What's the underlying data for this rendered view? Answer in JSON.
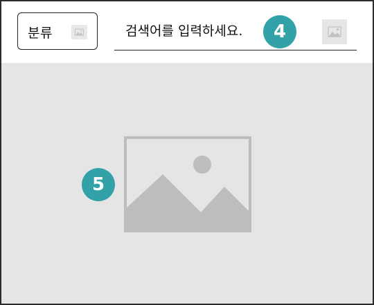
{
  "category": {
    "label": "분류",
    "icon": "image-placeholder-icon"
  },
  "search": {
    "placeholder": "검색어를 입력하세요.",
    "icon": "image-placeholder-icon"
  },
  "annotations": {
    "search_marker": "4",
    "content_marker": "5",
    "color": "#33a1a8"
  },
  "content": {
    "image_icon": "image-placeholder-icon"
  },
  "colors": {
    "content_background": "#e5e5e5",
    "placeholder_gray": "#bdbdbd"
  }
}
